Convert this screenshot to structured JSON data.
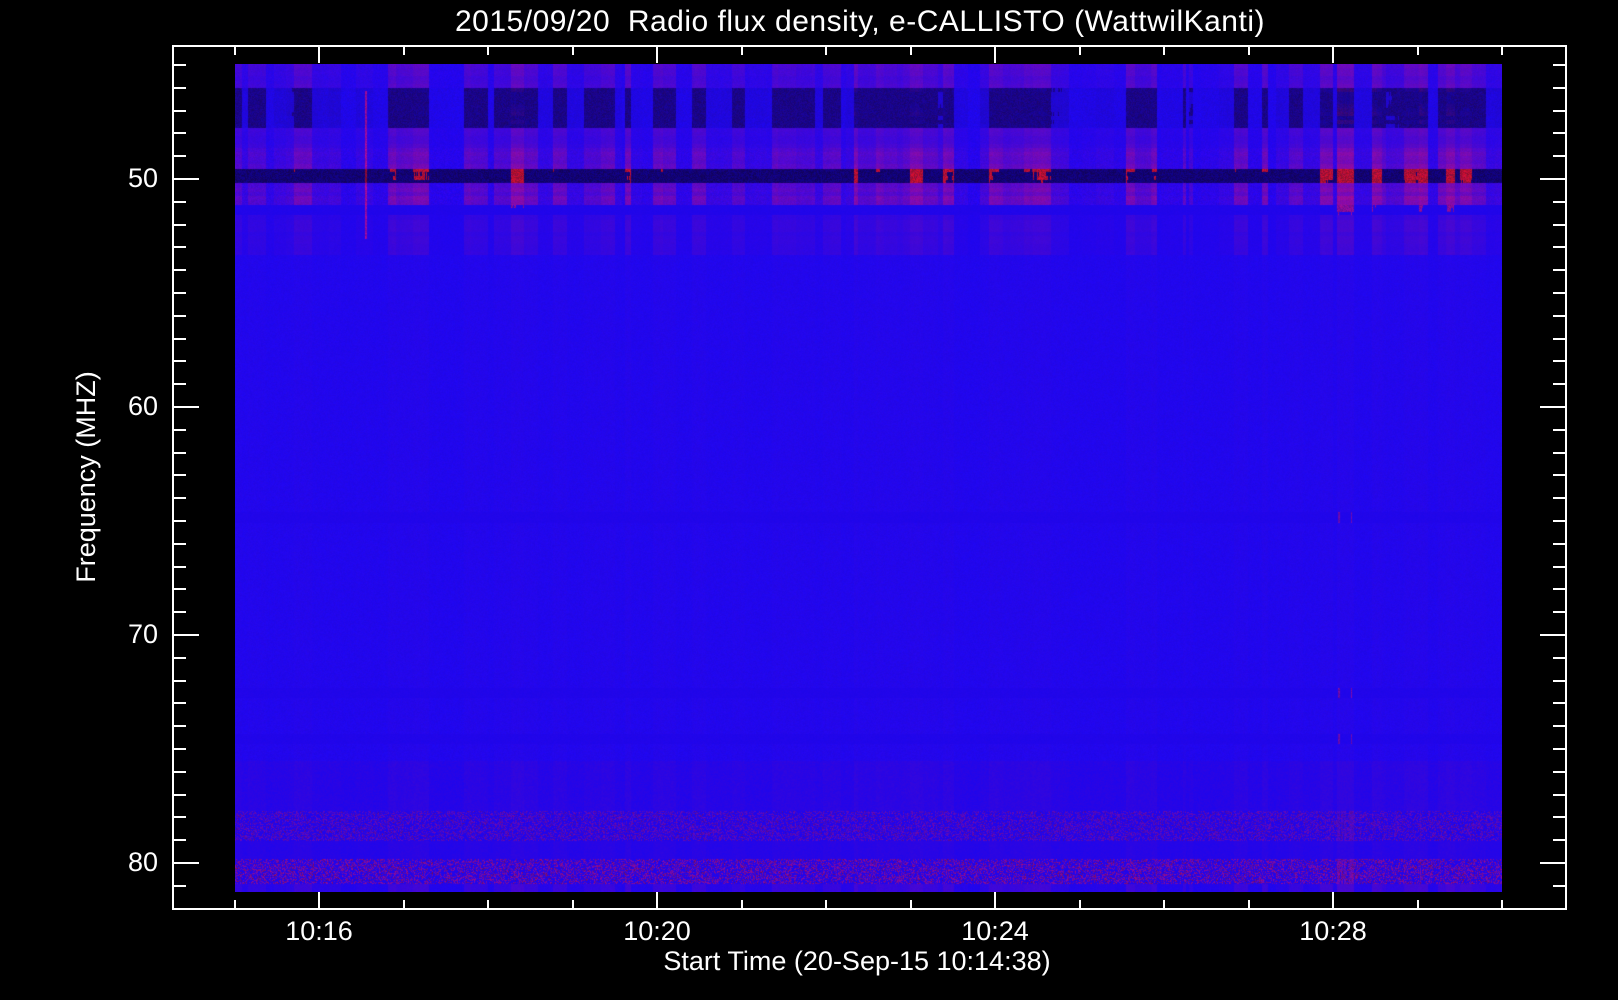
{
  "chart_data": {
    "type": "heatmap",
    "subtype": "radio-spectrogram",
    "title": "2015/09/20  Radio flux density, e-CALLISTO (WattwilKanti)",
    "xlabel": "Start Time (20-Sep-15 10:14:38)",
    "ylabel": "Frequency (MHZ)",
    "start_time_label": "10:14:38",
    "date_label": "2015/09/20",
    "instrument": "e-CALLISTO",
    "station": "WattwilKanti",
    "x_ticks_major": [
      "10:16",
      "10:20",
      "10:24",
      "10:28"
    ],
    "x_minor_tick_interval_min": 1,
    "x_image_span": [
      "10:15",
      "10:30"
    ],
    "y_ticks_major": [
      50,
      60,
      70,
      80
    ],
    "y_minor_tick_interval_mhz": 1,
    "y_range_mhz": [
      45.0,
      81.3
    ],
    "y_axis_increases_downward": true,
    "grid": false,
    "legend": "none",
    "palette": {
      "background": "#000000",
      "axis": "#ffffff",
      "text": "#ffffff",
      "base_blue": "#1e05ed",
      "stripe_purple_red": "#8c1464",
      "dark_navy": "#0c0290",
      "rfi_red": "#b01428",
      "speckle_red": "#7a1878"
    },
    "rfi_bands": [
      {
        "f0_mhz": 44.9,
        "f1_mhz": 46.0,
        "style": "stripes",
        "strength": 0.5,
        "desc": "moderate time-striped RFI near top edge"
      },
      {
        "f0_mhz": 46.0,
        "f1_mhz": 47.75,
        "style": "dark",
        "strength": 1.0,
        "desc": "strong broadcast band: dark navy with dark-red time stripes"
      },
      {
        "f0_mhz": 47.75,
        "f1_mhz": 48.6,
        "style": "stripes",
        "strength": 0.45,
        "desc": "weak striping"
      },
      {
        "f0_mhz": 48.6,
        "f1_mhz": 49.55,
        "style": "stripes",
        "strength": 0.7,
        "desc": "purple-red striping"
      },
      {
        "f0_mhz": 49.55,
        "f1_mhz": 50.15,
        "style": "line",
        "strength": 1.0,
        "desc": "intense carrier near 50 MHz: bright red / dark navy segments"
      },
      {
        "f0_mhz": 50.15,
        "f1_mhz": 51.1,
        "style": "stripes",
        "strength": 0.75,
        "desc": "purple-red striping"
      },
      {
        "f0_mhz": 51.1,
        "f1_mhz": 51.55,
        "style": "dots",
        "strength": 0.6,
        "desc": "dashed red row ~51.3 MHz"
      },
      {
        "f0_mhz": 51.55,
        "f1_mhz": 53.3,
        "style": "stripes",
        "strength": 0.28,
        "desc": "fading striping"
      },
      {
        "f0_mhz": 53.3,
        "f1_mhz": 64.6,
        "style": "quiet",
        "strength": 0.06,
        "desc": "quiet uniform blue"
      },
      {
        "f0_mhz": 64.6,
        "f1_mhz": 65.05,
        "style": "dots",
        "strength": 0.45,
        "desc": "faint dashed row ~64.8 MHz"
      },
      {
        "f0_mhz": 65.05,
        "f1_mhz": 72.3,
        "style": "quiet",
        "strength": 0.06,
        "desc": "quiet uniform blue"
      },
      {
        "f0_mhz": 72.3,
        "f1_mhz": 72.75,
        "style": "dots",
        "strength": 0.5,
        "desc": "faint dashed row ~72.5 MHz"
      },
      {
        "f0_mhz": 72.75,
        "f1_mhz": 74.3,
        "style": "quiet",
        "strength": 0.07,
        "desc": "quiet"
      },
      {
        "f0_mhz": 74.3,
        "f1_mhz": 74.75,
        "style": "dots",
        "strength": 0.45,
        "desc": "faint dashed row ~74.5 MHz"
      },
      {
        "f0_mhz": 74.75,
        "f1_mhz": 75.5,
        "style": "quiet",
        "strength": 0.07,
        "desc": "quiet"
      },
      {
        "f0_mhz": 75.5,
        "f1_mhz": 77.7,
        "style": "fuzzy",
        "strength": 0.22,
        "desc": "faint reddish haze"
      },
      {
        "f0_mhz": 77.7,
        "f1_mhz": 79.0,
        "style": "speckle",
        "strength": 0.45,
        "desc": "speckled RFI band"
      },
      {
        "f0_mhz": 79.0,
        "f1_mhz": 79.8,
        "style": "fuzzy",
        "strength": 0.18,
        "desc": "faint haze"
      },
      {
        "f0_mhz": 79.8,
        "f1_mhz": 80.9,
        "style": "speckle",
        "strength": 0.68,
        "desc": "dense speckled RFI band near 80 MHz"
      },
      {
        "f0_mhz": 80.9,
        "f1_mhz": 81.3,
        "style": "stripes",
        "strength": 0.3,
        "desc": "bottom edge striping"
      }
    ],
    "vertical_event": {
      "time": "10:16:33",
      "f0_mhz": 46.1,
      "f1_mhz": 52.6,
      "desc": "thin red vertical streak"
    }
  }
}
